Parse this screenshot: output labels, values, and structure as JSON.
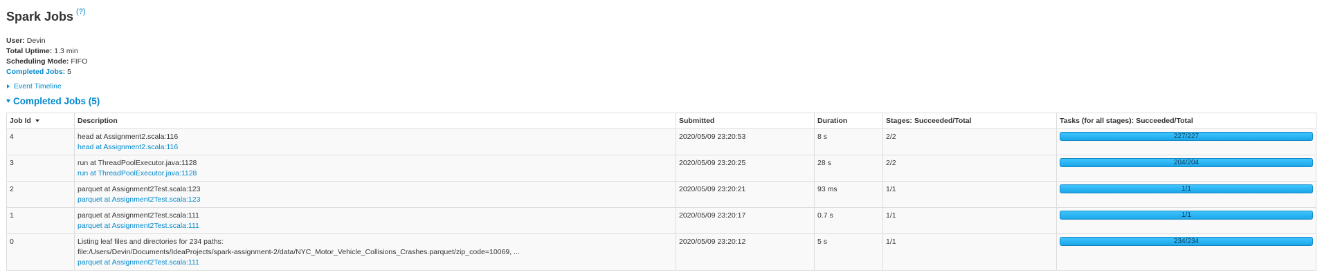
{
  "header": {
    "title": "Spark Jobs",
    "help": "(?)"
  },
  "summary": {
    "user_label": "User:",
    "user": "Devin",
    "uptime_label": "Total Uptime:",
    "uptime": "1.3 min",
    "mode_label": "Scheduling Mode:",
    "mode": "FIFO",
    "completed_label": "Completed Jobs:",
    "completed": "5"
  },
  "timeline_label": "Event Timeline",
  "section_title": "Completed Jobs (5)",
  "columns": [
    "Job Id",
    "Description",
    "Submitted",
    "Duration",
    "Stages: Succeeded/Total",
    "Tasks (for all stages): Succeeded/Total"
  ],
  "jobs": [
    {
      "id": "4",
      "desc": "head at Assignment2.scala:116",
      "link": "head at Assignment2.scala:116",
      "submitted": "2020/05/09 23:20:53",
      "duration": "8 s",
      "stages": "2/2",
      "tasks": "227/227",
      "progress": 1.0
    },
    {
      "id": "3",
      "desc": "run at ThreadPoolExecutor.java:1128",
      "link": "run at ThreadPoolExecutor.java:1128",
      "submitted": "2020/05/09 23:20:25",
      "duration": "28 s",
      "stages": "2/2",
      "tasks": "204/204",
      "progress": 1.0
    },
    {
      "id": "2",
      "desc": "parquet at Assignment2Test.scala:123",
      "link": "parquet at Assignment2Test.scala:123",
      "submitted": "2020/05/09 23:20:21",
      "duration": "93 ms",
      "stages": "1/1",
      "tasks": "1/1",
      "progress": 1.0
    },
    {
      "id": "1",
      "desc": "parquet at Assignment2Test.scala:111",
      "link": "parquet at Assignment2Test.scala:111",
      "submitted": "2020/05/09 23:20:17",
      "duration": "0.7 s",
      "stages": "1/1",
      "tasks": "1/1",
      "progress": 1.0
    },
    {
      "id": "0",
      "desc": "Listing leaf files and directories for 234 paths:",
      "desc2": "file:/Users/Devin/Documents/IdeaProjects/spark-assignment-2/data/NYC_Motor_Vehicle_Collisions_Crashes.parquet/zip_code=10069, ...",
      "link": "parquet at Assignment2Test.scala:111",
      "submitted": "2020/05/09 23:20:12",
      "duration": "5 s",
      "stages": "1/1",
      "tasks": "234/234",
      "progress": 1.0
    }
  ]
}
